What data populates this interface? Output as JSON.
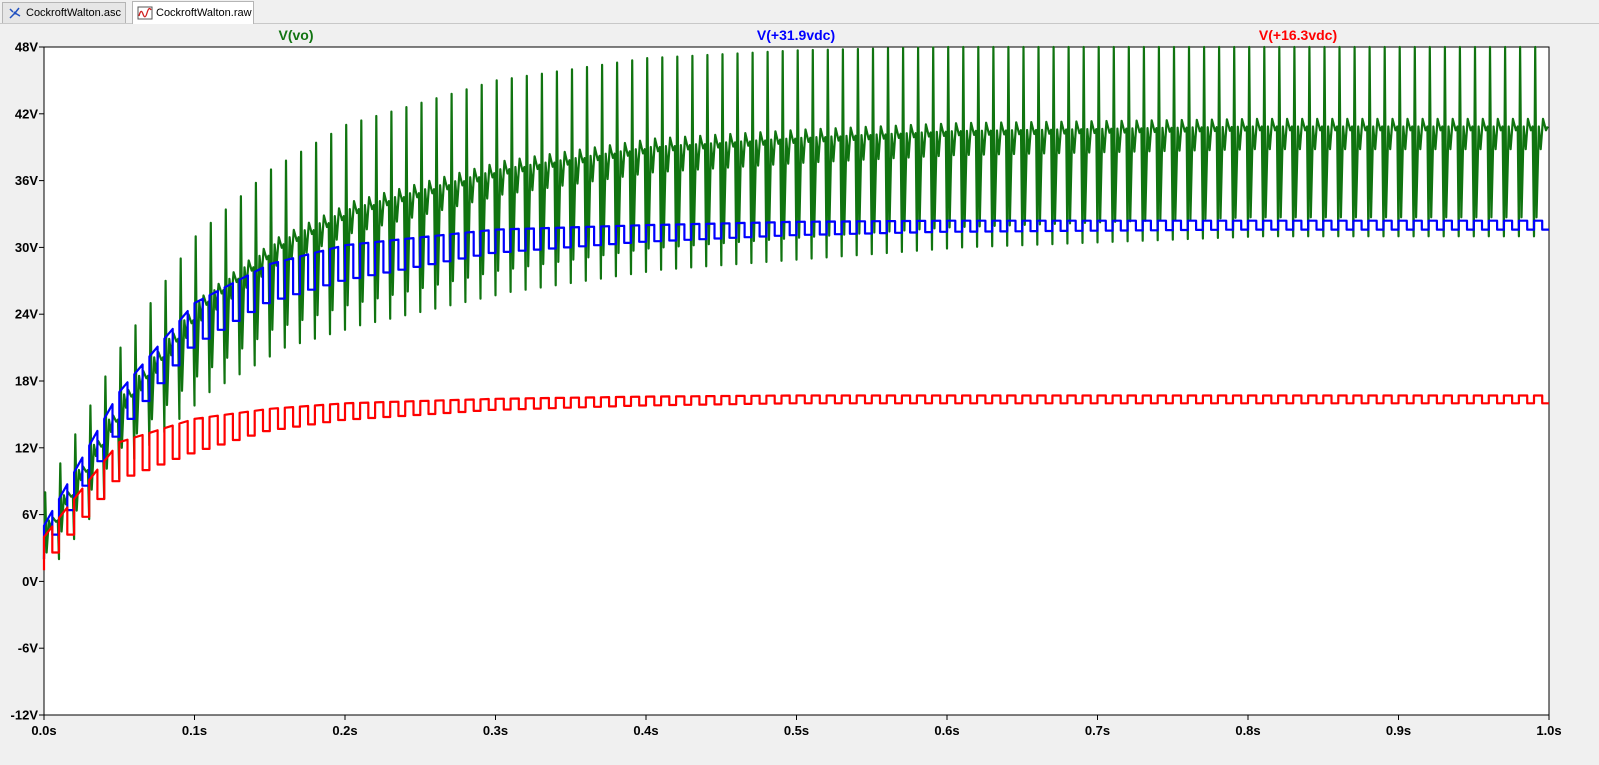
{
  "tabs": [
    {
      "label": "CockroftWalton.asc",
      "icon": "schematic-icon",
      "active": false
    },
    {
      "label": "CockroftWalton.raw",
      "icon": "waveform-icon",
      "active": true
    }
  ],
  "colors": {
    "green": "#107410",
    "blue": "#0000ff",
    "red": "#ff0000",
    "plot_bg": "#ffffff"
  },
  "chart_data": {
    "type": "line",
    "title": "",
    "xlabel": "",
    "ylabel": "",
    "xlim": [
      0,
      1.0
    ],
    "ylim": [
      -12,
      48
    ],
    "grid": false,
    "x_ticks": [
      "0.0s",
      "0.1s",
      "0.2s",
      "0.3s",
      "0.4s",
      "0.5s",
      "0.6s",
      "0.7s",
      "0.8s",
      "0.9s",
      "1.0s"
    ],
    "y_ticks": [
      "48V",
      "42V",
      "36V",
      "30V",
      "24V",
      "18V",
      "12V",
      "6V",
      "0V",
      "-6V",
      "-12V"
    ],
    "series": [
      {
        "name": "V(vo)",
        "color": "#107410",
        "envelope_t": [
          0,
          0.05,
          0.1,
          0.15,
          0.2,
          0.3,
          0.4,
          0.5,
          0.6,
          0.8,
          1.0
        ],
        "peak": [
          8,
          21,
          31,
          37,
          41,
          45,
          47,
          47.7,
          48,
          48,
          48
        ],
        "dip": [
          2,
          11,
          17,
          21,
          23,
          26,
          28,
          29,
          30,
          31,
          31
        ]
      },
      {
        "name": "V(+31.9vdc)",
        "color": "#0000ff",
        "envelope_t": [
          0,
          0.05,
          0.1,
          0.15,
          0.2,
          0.3,
          0.4,
          0.5,
          0.6,
          0.8,
          1.0
        ],
        "high": [
          5,
          17,
          25,
          28.5,
          30.2,
          31.6,
          32,
          32.3,
          32.4,
          32.4,
          32.4
        ],
        "low": [
          2,
          13,
          21,
          25,
          27,
          29.5,
          30.5,
          31.1,
          31.4,
          31.6,
          31.6
        ]
      },
      {
        "name": "V(+16.3vdc)",
        "color": "#ff0000",
        "envelope_t": [
          0,
          0.05,
          0.1,
          0.15,
          0.2,
          0.3,
          0.4,
          0.5,
          0.6,
          0.8,
          1.0
        ],
        "high": [
          4,
          12.5,
          14.6,
          15.5,
          16,
          16.4,
          16.6,
          16.7,
          16.7,
          16.7,
          16.7
        ],
        "low": [
          1,
          9,
          11.5,
          13.5,
          14.5,
          15.4,
          15.8,
          16,
          16,
          16,
          16
        ]
      }
    ]
  }
}
